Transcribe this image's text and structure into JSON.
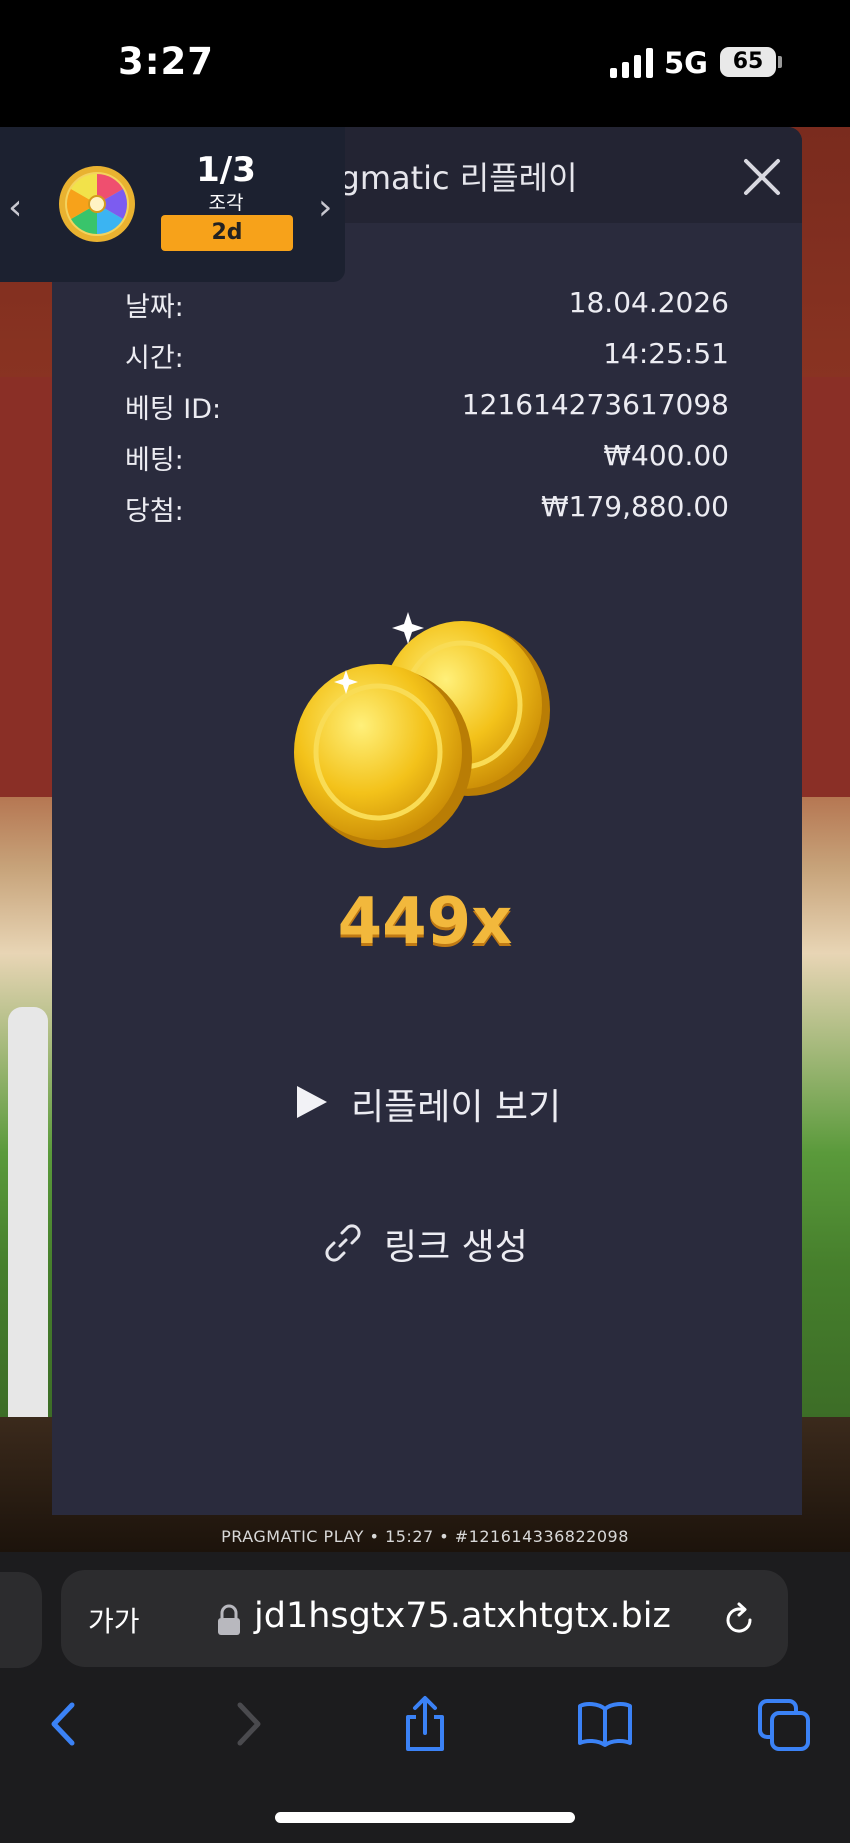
{
  "status_bar": {
    "time": "3:27",
    "network": "5G",
    "battery": "65"
  },
  "modal": {
    "title": "Pragmatic 리플레이",
    "details": [
      {
        "label": "날짜:",
        "value": "18.04.2026"
      },
      {
        "label": "시간:",
        "value": "14:25:51"
      },
      {
        "label": "베팅 ID:",
        "value": "121614273617098"
      },
      {
        "label": "베팅:",
        "value": "₩400.00"
      },
      {
        "label": "당첨:",
        "value": "₩179,880.00"
      }
    ],
    "multiplier": "449x",
    "replay_label": "리플레이 보기",
    "link_label": "링크 생성"
  },
  "promo": {
    "fraction": "1/3",
    "piece_label": "조각",
    "days": "2d"
  },
  "game_footer": "PRAGMATIC PLAY • 15:27 • #121614336822098",
  "browser": {
    "text_size": "가가",
    "url": "jd1hsgtx75.atxhtgtx.biz"
  },
  "icons": {
    "close": "close-icon",
    "play": "play-icon",
    "link": "link-icon",
    "lock": "lock-icon",
    "reload": "reload-icon",
    "back": "back-icon",
    "forward": "forward-icon",
    "share": "share-icon",
    "bookmarks": "bookmarks-icon",
    "tabs": "tabs-icon"
  },
  "colors": {
    "accent": "#f7a21a",
    "modal_bg": "#2a2b3d",
    "safari_blue": "#3b82f6"
  }
}
